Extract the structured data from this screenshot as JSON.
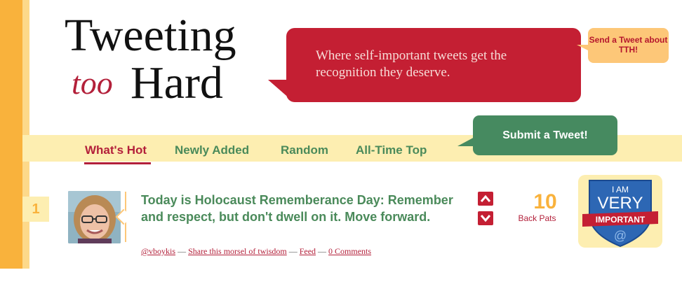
{
  "header": {
    "logo": {
      "line1": "Tweeting",
      "line2": "too",
      "line3": "Hard"
    },
    "tagline": "Where self-important tweets get the recognition they deserve.",
    "send_tweet": "Send a Tweet about TTH!"
  },
  "nav": {
    "items": [
      {
        "label": "What's Hot"
      },
      {
        "label": "Newly Added"
      },
      {
        "label": "Random"
      },
      {
        "label": "All-Time Top"
      }
    ],
    "active": "What's Hot"
  },
  "submit_button": "Submit a Tweet!",
  "tweet": {
    "rank": "1",
    "text": "Today is Holocaust Rememberance Day: Remember and respect, but don't dwell on it. Move forward.",
    "author": "@vboykis",
    "share": "Share this morsel of twisdom",
    "feed": "Feed",
    "comments": "0 Comments",
    "pats_count": "10",
    "pats_label": "Back Pats"
  },
  "badge": {
    "line1": "I AM",
    "line2": "VERY",
    "line3": "IMPORTANT",
    "line4": "@"
  },
  "colors": {
    "accent_red": "#c41f33",
    "accent_green": "#468a60",
    "accent_orange": "#f9b23c",
    "pale_yellow": "#fdeeb1"
  }
}
